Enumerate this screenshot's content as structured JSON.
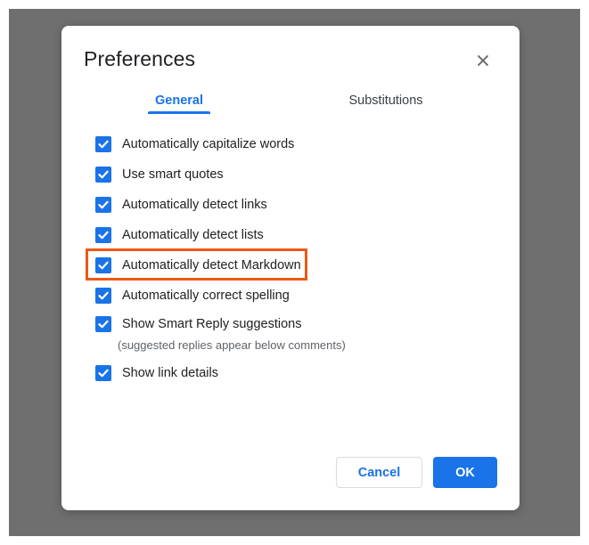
{
  "dialog": {
    "title": "Preferences",
    "close_icon": "close-icon"
  },
  "tabs": [
    {
      "label": "General",
      "active": true
    },
    {
      "label": "Substitutions",
      "active": false
    }
  ],
  "options": [
    {
      "label": "Automatically capitalize words",
      "checked": true
    },
    {
      "label": "Use smart quotes",
      "checked": true
    },
    {
      "label": "Automatically detect links",
      "checked": true
    },
    {
      "label": "Automatically detect lists",
      "checked": true
    },
    {
      "label": "Automatically detect Markdown",
      "checked": true,
      "highlighted": true
    },
    {
      "label": "Automatically correct spelling",
      "checked": true
    },
    {
      "label": "Show Smart Reply suggestions",
      "checked": true,
      "note": "(suggested replies appear below comments)"
    },
    {
      "label": "Show link details",
      "checked": true
    }
  ],
  "buttons": {
    "cancel": "Cancel",
    "ok": "OK"
  },
  "colors": {
    "accent": "#1a73e8",
    "highlight": "#ec5a13",
    "backdrop": "#6f6f6f"
  }
}
